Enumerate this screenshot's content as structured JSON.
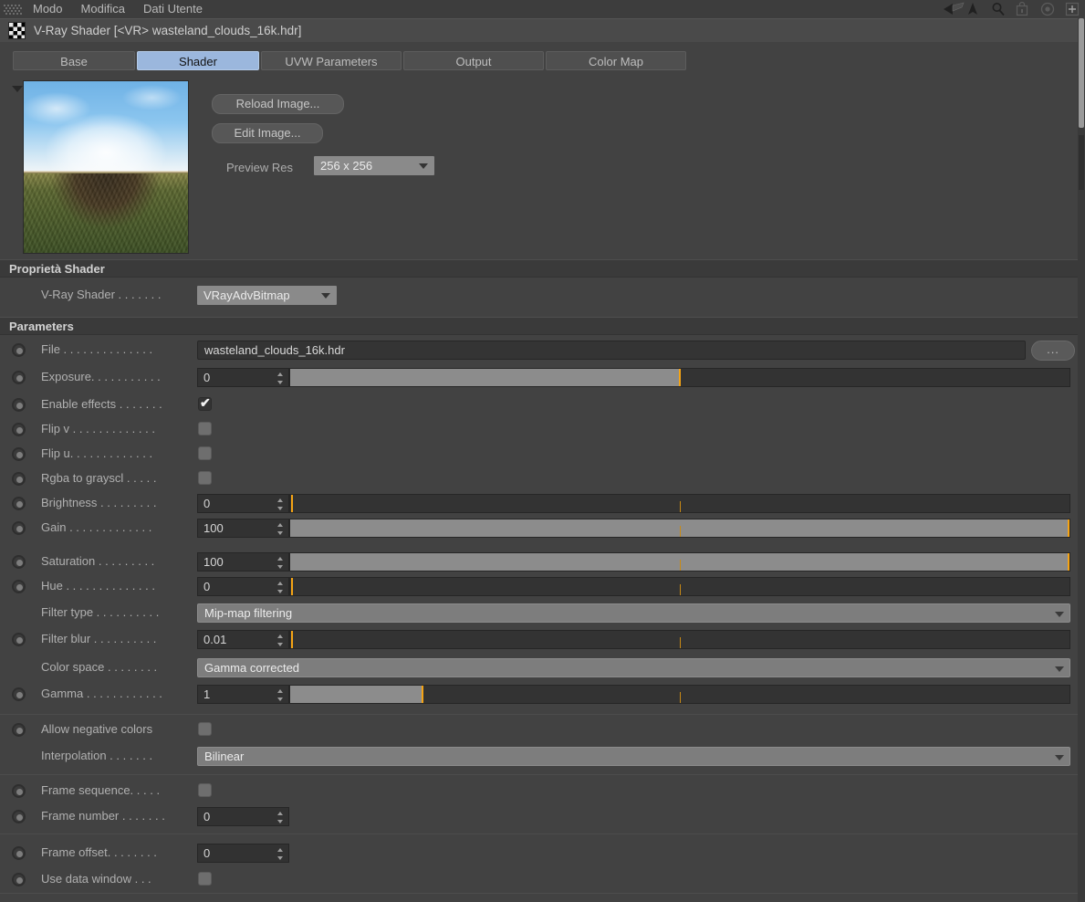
{
  "menubar": {
    "grip_icon": "grip-dots-icon",
    "items": [
      {
        "label": "Modo"
      },
      {
        "label": "Modifica"
      },
      {
        "label": "Dati Utente"
      }
    ],
    "right_icons": [
      {
        "name": "brush-arrow-icon"
      },
      {
        "name": "cursor-arrow-icon"
      },
      {
        "name": "magnifier-icon"
      },
      {
        "name": "lock-icon"
      },
      {
        "name": "target-icon"
      },
      {
        "name": "plus-icon"
      }
    ]
  },
  "titlebar": {
    "icon": "checkerboard-icon",
    "title": "V-Ray Shader [<VR> wasteland_clouds_16k.hdr]"
  },
  "tabs": [
    {
      "label": "Base",
      "selected": false
    },
    {
      "label": "Shader",
      "selected": true
    },
    {
      "label": "UVW Parameters",
      "selected": false
    },
    {
      "label": "Output",
      "selected": false
    },
    {
      "label": "Color Map",
      "selected": false
    }
  ],
  "preview": {
    "collapse_icon": "triangle-down-icon",
    "thumbnail_alt": "hdri-panorama-preview",
    "reload_button": "Reload Image...",
    "edit_button": "Edit Image...",
    "preview_res_label": "Preview Res",
    "preview_res_value": "256 x 256"
  },
  "shader_properties": {
    "header": "Proprietà Shader",
    "shader_label": "V-Ray Shader . . . . . . .",
    "shader_value": "VRayAdvBitmap"
  },
  "parameters": {
    "header": "Parameters",
    "file": {
      "label": "File . . . . . . . . . . . . . .",
      "value": "wasteland_clouds_16k.hdr",
      "browse": "..."
    },
    "exposure": {
      "label": "Exposure. . . . . . . . . . .",
      "value": "0",
      "fill_pct": 50
    },
    "enable_effects": {
      "label": "Enable effects . . . . . . .",
      "checked": true
    },
    "flip_v": {
      "label": "Flip v . . . . . . . . . . . . .",
      "checked": false
    },
    "flip_u": {
      "label": "Flip u. . . . . . . . . . . . .",
      "checked": false
    },
    "rgba_to_grayscale": {
      "label": "Rgba to grayscl . . . . .",
      "checked": false
    },
    "brightness": {
      "label": "Brightness . . . . . . . . .",
      "value": "0",
      "fill_pct": 0
    },
    "gain": {
      "label": "Gain . . . . . . . . . . . . .",
      "value": "100",
      "fill_pct": 100
    },
    "saturation": {
      "label": "Saturation . . . . . . . . .",
      "value": "100",
      "fill_pct": 100
    },
    "hue": {
      "label": "Hue . . . . . . . . . . . . . .",
      "value": "0",
      "fill_pct": 0
    },
    "filter_type": {
      "label": "Filter type . . . . . . . . . .",
      "value": "Mip-map filtering"
    },
    "filter_blur": {
      "label": "Filter blur . . . . . . . . . .",
      "value": "0.01",
      "fill_pct": 0
    },
    "color_space": {
      "label": "Color space . . . . . . . .",
      "value": "Gamma corrected"
    },
    "gamma": {
      "label": "Gamma . . . . . . . . . . . .",
      "value": "1",
      "fill_pct": 17
    },
    "allow_negative_colors": {
      "label": "Allow negative colors",
      "checked": false
    },
    "interpolation": {
      "label": "Interpolation . . . . . . .",
      "value": "Bilinear"
    },
    "frame_sequence": {
      "label": "Frame sequence. . . . .",
      "checked": false
    },
    "frame_number": {
      "label": "Frame number . . . . . . .",
      "value": "0"
    },
    "frame_offset": {
      "label": "Frame offset. . . . . . . .",
      "value": "0"
    },
    "use_data_window": {
      "label": "Use data window . . .",
      "checked": false
    }
  },
  "colors": {
    "background": "#424242",
    "accent_tab": "#9bb7dd",
    "slider_knob": "#f5a415",
    "slider_fill": "#8c8c8c",
    "field_bg": "#323232"
  }
}
